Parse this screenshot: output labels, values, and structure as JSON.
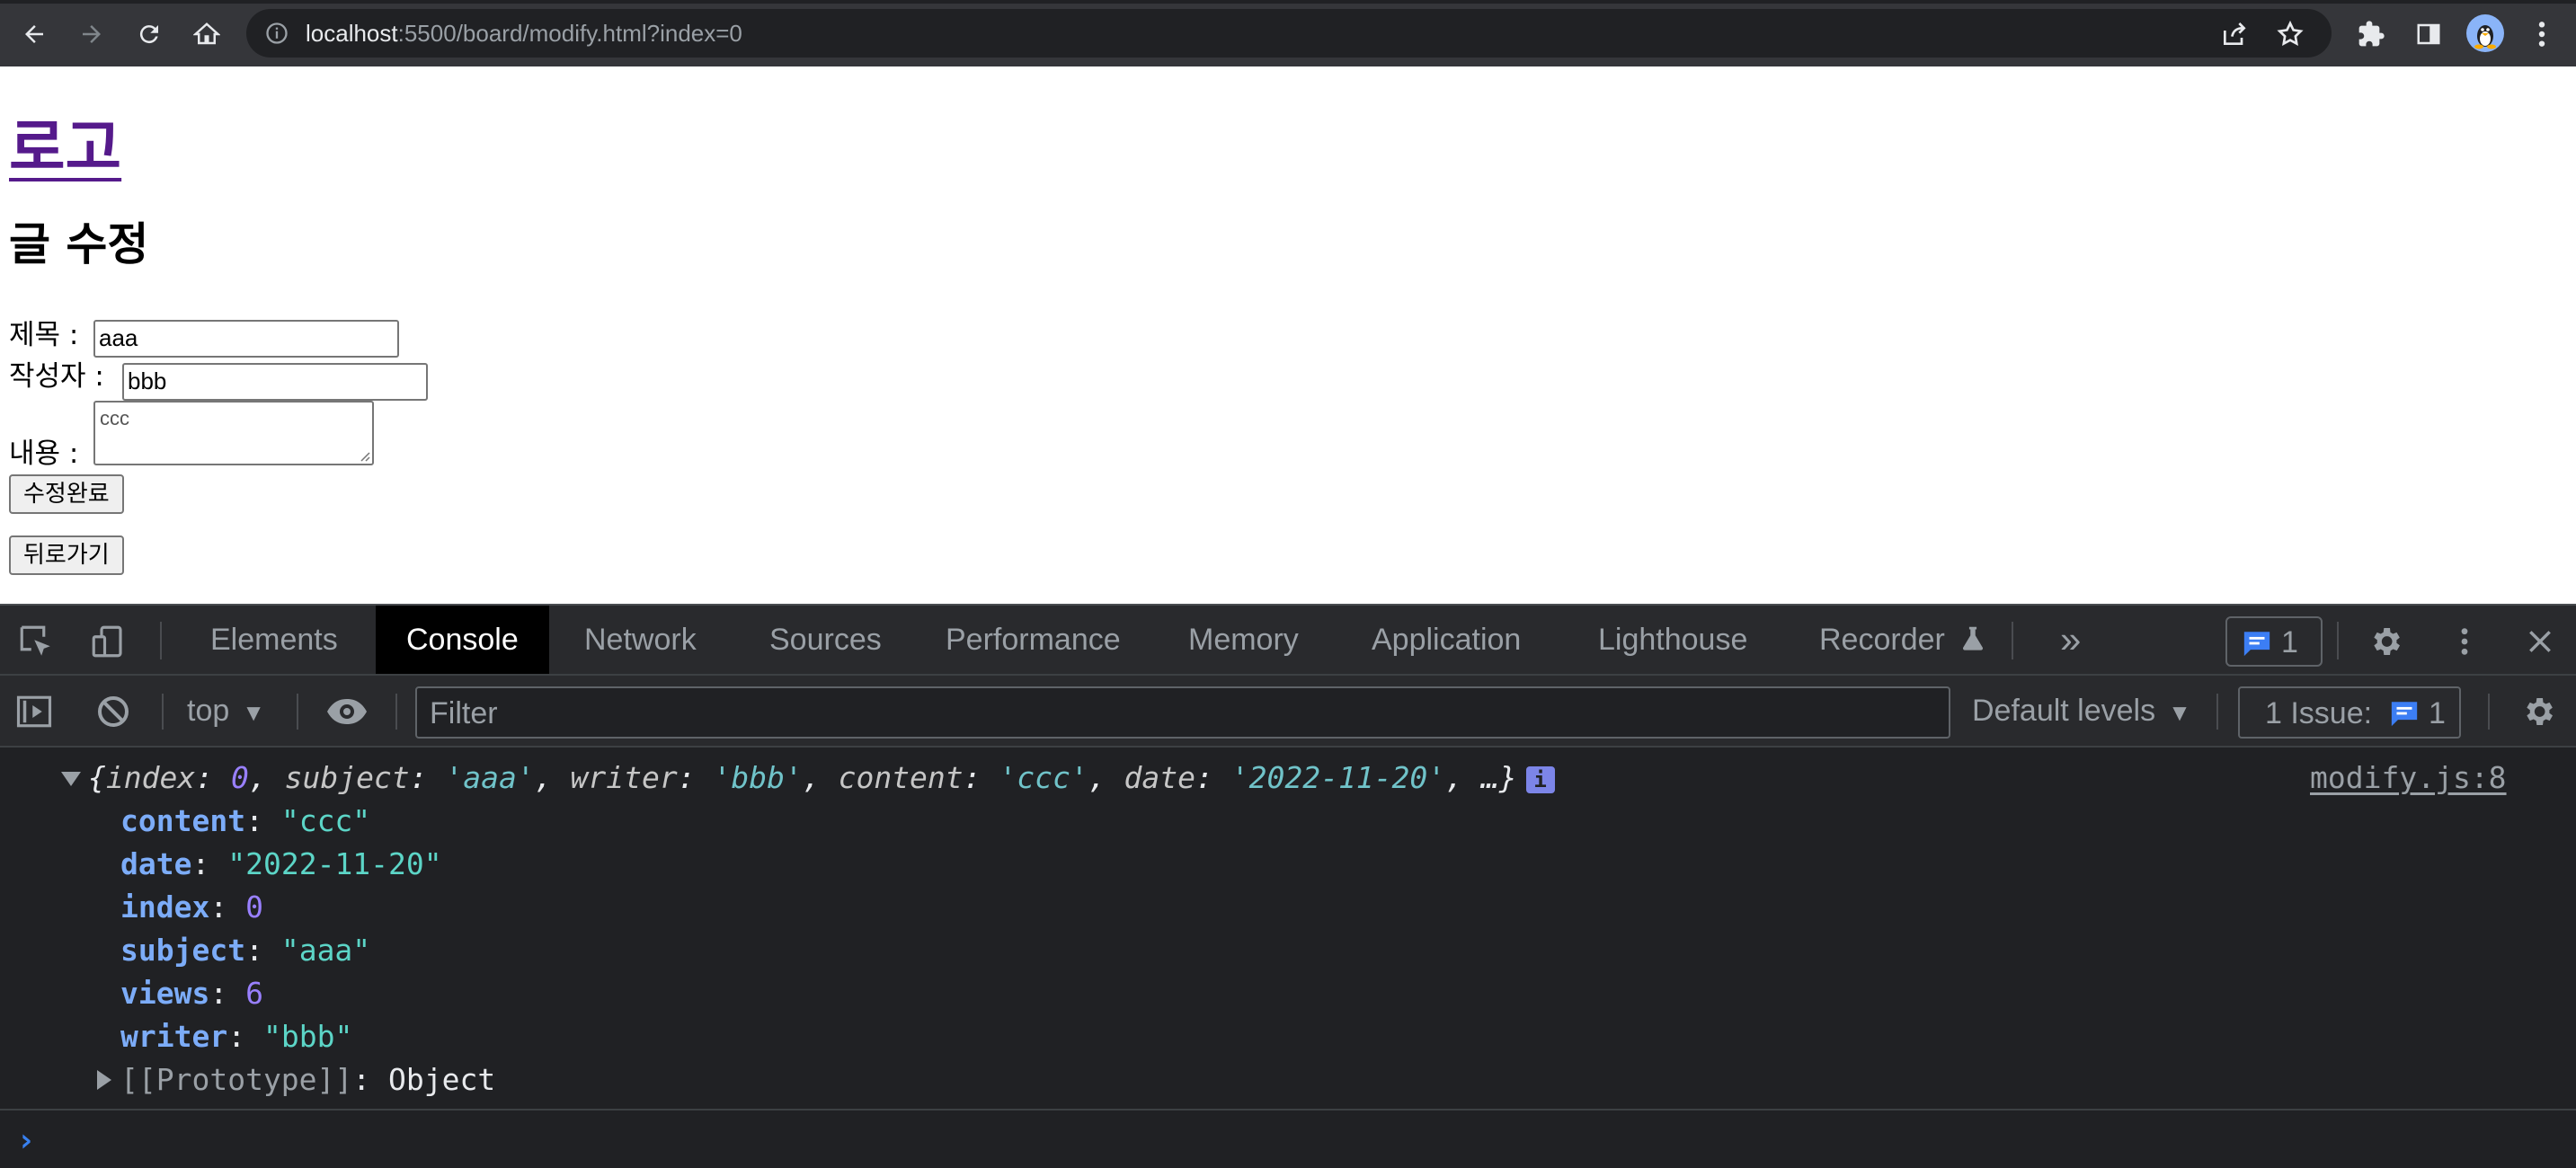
{
  "browser": {
    "url_host": "localhost",
    "url_rest": ":5500/board/modify.html?index=0"
  },
  "page": {
    "logo": "로고",
    "title": "글 수정",
    "form": {
      "subject_label": "제목 :",
      "subject_value": "aaa",
      "writer_label": "작성자 :",
      "writer_value": "bbb",
      "content_label": "내용 :",
      "content_value": "ccc",
      "submit_label": "수정완료",
      "back_label": "뒤로가기"
    }
  },
  "devtools": {
    "tabs": [
      {
        "label": "Elements"
      },
      {
        "label": "Console"
      },
      {
        "label": "Network"
      },
      {
        "label": "Sources"
      },
      {
        "label": "Performance"
      },
      {
        "label": "Memory"
      },
      {
        "label": "Application"
      },
      {
        "label": "Lighthouse"
      },
      {
        "label": "Recorder"
      }
    ],
    "active_tab": "Console",
    "more_tabs": "»",
    "issues_count": "1",
    "toolbar": {
      "context": "top",
      "filter_placeholder": "Filter",
      "levels": "Default levels",
      "issue_label": "1 Issue:",
      "issue_count": "1"
    },
    "console": {
      "source": "modify.js:8",
      "summary": {
        "open": "{",
        "k1": "index",
        "v1": "0",
        "k2": "subject",
        "v2": "'aaa'",
        "k3": "writer",
        "v3": "'bbb'",
        "k4": "content",
        "v4": "'ccc'",
        "k5": "date",
        "v5": "'2022-11-20'",
        "tail": "…}"
      },
      "props": [
        {
          "key": "content",
          "value": "\"ccc\""
        },
        {
          "key": "date",
          "value": "\"2022-11-20\""
        },
        {
          "key": "index",
          "value": "0"
        },
        {
          "key": "subject",
          "value": "\"aaa\""
        },
        {
          "key": "views",
          "value": "6"
        },
        {
          "key": "writer",
          "value": "\"bbb\""
        }
      ],
      "prototype_key": "[[Prototype]]",
      "prototype_value": "Object",
      "prompt": "›"
    }
  },
  "colors": {
    "chrome_bg": "#35363a",
    "omnibox_bg": "#202124",
    "visited_link": "#551a8b",
    "devtools_bg": "#202124",
    "active_tab_bg": "#000000",
    "console_key": "#7cacf8",
    "console_string": "#5cd5c7",
    "console_number": "#9980ff",
    "badge_blue": "#3c7ef4"
  }
}
